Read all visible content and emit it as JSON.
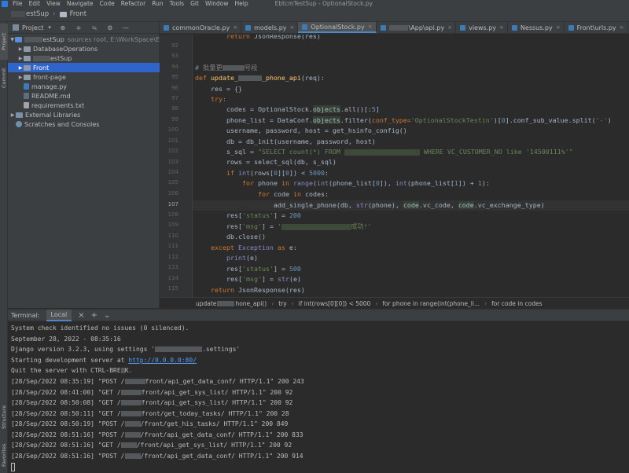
{
  "menubar": {
    "items": [
      "File",
      "Edit",
      "View",
      "Navigate",
      "Code",
      "Refactor",
      "Run",
      "Tools",
      "Git",
      "Window",
      "Help"
    ],
    "window_title": "EbtcmTestSup - OptionalStock.py"
  },
  "navbar": {
    "project": "estSup",
    "folder": "Front"
  },
  "left_strip": {
    "project_label": "Project",
    "commit_label": "Commit",
    "structure_label": "Structure",
    "favorites_label": "Favorites"
  },
  "project_panel": {
    "title": "Project",
    "root_name": "estSup",
    "root_path": "sources root,  E:\\WorkSpace\\E",
    "items": [
      {
        "label": "DatabaseOperations",
        "type": "folder"
      },
      {
        "label": "estSup",
        "type": "folder"
      },
      {
        "label": "Front",
        "type": "folder"
      },
      {
        "label": "front-page",
        "type": "folder"
      },
      {
        "label": "manage.py",
        "type": "py"
      },
      {
        "label": "README.md",
        "type": "md"
      },
      {
        "label": "requirements.txt",
        "type": "txt"
      },
      {
        "label": "External Libraries",
        "type": "lib"
      },
      {
        "label": "Scratches and Consoles",
        "type": "scratch"
      }
    ]
  },
  "tabs": [
    {
      "label": "commonOracle.py"
    },
    {
      "label": "models.py"
    },
    {
      "label": "OptionalStock.py",
      "active": true
    },
    {
      "label": "\\App\\api.py"
    },
    {
      "label": "views.py"
    },
    {
      "label": "Nessus.py"
    },
    {
      "label": "Front\\urls.py"
    }
  ],
  "editor": {
    "line_numbers": [
      "92",
      "93",
      "94",
      "95",
      "96",
      "97",
      "98",
      "99",
      "100",
      "101",
      "102",
      "103",
      "104",
      "105",
      "106",
      "107",
      "108",
      "109",
      "110",
      "111",
      "112",
      "113",
      "114",
      "115"
    ],
    "current_line": "107",
    "lines": {
      "l92": "return JsonResponse(res)",
      "l95": "# 批量更",
      "l95b": "号段",
      "l96_def": "def ",
      "l96_name": "update_",
      "l96_name2": "_phone_api",
      "l96_args": "(req):",
      "l97": "res = {}",
      "l98": "try:",
      "l99_a": "codes = OptionalStock.",
      "l99_b": "objects",
      "l99_c": ".all()[:",
      "l99_d": "5",
      "l99_e": "]",
      "l100_a": "phone_list = DataConf.",
      "l100_b": "objects",
      "l100_c": ".filter(",
      "l100_d": "conf_type=",
      "l100_e": "'OptionalStockTestin'",
      "l100_f": ")[",
      "l100_g": "0",
      "l100_h": "].conf_sub_value.split(",
      "l100_i": "'-'",
      "l100_j": ")",
      "l101": "username, password, host = get_hsinfo_config()",
      "l102": "db = db_init(username, password, host)",
      "l103_a": "s_sql = ",
      "l103_b": "\"SELECT count(*) FROM ",
      "l103_c": " WHERE VC_CUSTOMER_NO like '14500111%'\"",
      "l104": "rows = select_sql(db, s_sql)",
      "l105_a": "if ",
      "l105_b": "int",
      "l105_c": "(rows[",
      "l105_d": "0",
      "l105_e": "][",
      "l105_f": "0",
      "l105_g": "]) < ",
      "l105_h": "5000",
      "l105_i": ":",
      "l106_a": "for ",
      "l106_b": "phone ",
      "l106_c": "in ",
      "l106_d": "range",
      "l106_e": "(",
      "l106_f": "int",
      "l106_g": "(phone_list[",
      "l106_h": "0",
      "l106_i": "]), ",
      "l106_j": "int",
      "l106_k": "(phone_list[",
      "l106_l": "1",
      "l106_m": "]) + ",
      "l106_n": "1",
      "l106_o": "):",
      "l107_a": "for ",
      "l107_b": "code ",
      "l107_c": "in ",
      "l107_d": "codes:",
      "l108_a": "add_single_phone(db, ",
      "l108_b": "str",
      "l108_c": "(phone), ",
      "l108_d": "code",
      "l108_e": ".vc_code, ",
      "l108_f": "code",
      "l108_g": ".vc_exchange_type)",
      "l109_a": "res[",
      "l109_b": "'status'",
      "l109_c": "] = ",
      "l109_d": "200",
      "l110_a": "res[",
      "l110_b": "'msg'",
      "l110_c": "] = ",
      "l110_d": "'",
      "l110_e": "成功!'",
      "l111": "db.close()",
      "l112_a": "except ",
      "l112_b": "Exception ",
      "l112_c": "as ",
      "l112_d": "e:",
      "l113_a": "print",
      "l113_b": "(e)",
      "l114_a": "res[",
      "l114_b": "'status'",
      "l114_c": "] = ",
      "l114_d": "500",
      "l115_a": "res[",
      "l115_b": "'msg'",
      "l115_c": "] = ",
      "l115_d": "str",
      "l115_e": "(e)",
      "l116_a": "return ",
      "l116_b": "JsonResponse(res)"
    }
  },
  "breadcrumbs": [
    "update",
    "hone_api()",
    "try",
    "if int(rows[0][0]) < 5000",
    "for phone in range(int(phone_li...",
    "for code in codes"
  ],
  "terminal": {
    "title": "Terminal:",
    "tab": "Local",
    "lines": [
      "System check identified no issues (0 silenced).",
      "September 28, 2022 - 08:35:16",
      "Django version 3.2.3, using settings '",
      "Starting development server at ",
      "Quit the server with CTRL-BRE",
      "[28/Sep/2022 08:35:19] \"POST /",
      "[28/Sep/2022 08:41:00] \"GET /",
      "[28/Sep/2022 08:50:08] \"GET /",
      "[28/Sep/2022 08:50:11] \"GET /",
      "[28/Sep/2022 08:50:19] \"POST /",
      "[28/Sep/2022 08:51:16] \"POST /",
      "[28/Sep/2022 08:51:16] \"GET /",
      "[28/Sep/2022 08:51:16] \"POST /"
    ],
    "settings_suffix": ".settings'",
    "server_url": "http://0.0.0.0:80/",
    "quit_suffix": "K.",
    "request_suffixes": [
      "front/api_get_data_conf/ HTTP/1.1\" 200 243",
      "front/api_get_sys_list/ HTTP/1.1\" 200 92",
      "front/api_get_sys_list/ HTTP/1.1\" 200 92",
      "front/get_today_tasks/ HTTP/1.1\" 200 28",
      "/front/get_his_tasks/ HTTP/1.1\" 200 849",
      "/front/api_get_data_conf/ HTTP/1.1\" 200 833",
      "/front/api_get_sys_list/ HTTP/1.1\" 200 92",
      "/front/api_get_data_conf/ HTTP/1.1\" 200 914"
    ]
  }
}
